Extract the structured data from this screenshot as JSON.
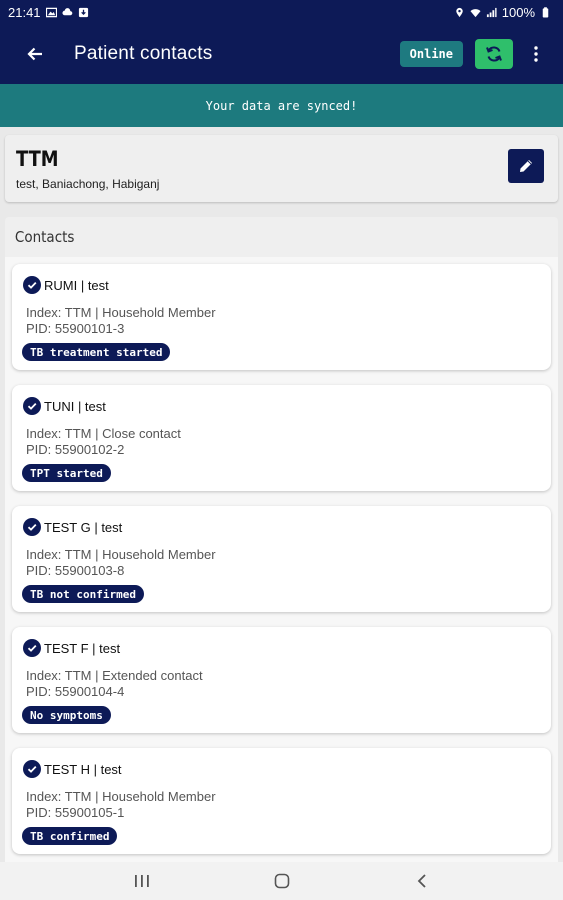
{
  "status_bar": {
    "time": "21:41",
    "battery": "100%"
  },
  "toolbar": {
    "title": "Patient contacts",
    "online_label": "Online"
  },
  "banner": {
    "text": "Your data are synced!"
  },
  "patient": {
    "name": "TTM",
    "location": "test, Baniachong, Habiganj"
  },
  "contacts": {
    "header": "Contacts",
    "items": [
      {
        "name": "RUMI | test",
        "index": "Index: TTM | Household Member",
        "pid": "PID: 55900101-3",
        "status": "TB treatment started"
      },
      {
        "name": "TUNI | test",
        "index": "Index: TTM | Close contact",
        "pid": "PID: 55900102-2",
        "status": "TPT started"
      },
      {
        "name": "TEST G | test",
        "index": "Index: TTM | Household Member",
        "pid": "PID: 55900103-8",
        "status": "TB not confirmed"
      },
      {
        "name": "TEST F | test",
        "index": "Index: TTM | Extended contact",
        "pid": "PID: 55900104-4",
        "status": "No symptoms"
      },
      {
        "name": "TEST H | test",
        "index": "Index: TTM | Household Member",
        "pid": "PID: 55900105-1",
        "status": "TB confirmed"
      }
    ]
  },
  "icons": {
    "back": "arrow-back-icon",
    "sync": "sync-icon",
    "more": "more-vert-icon",
    "edit": "pencil-icon",
    "check": "check-circle-icon",
    "nav_recents": "recents-icon",
    "nav_home": "home-icon",
    "nav_back": "back-chevron-icon"
  },
  "colors": {
    "primary": "#0d1a57",
    "banner": "#1d7a7e",
    "online_badge": "#1e7a80",
    "sync_button": "#2fbf6b"
  }
}
